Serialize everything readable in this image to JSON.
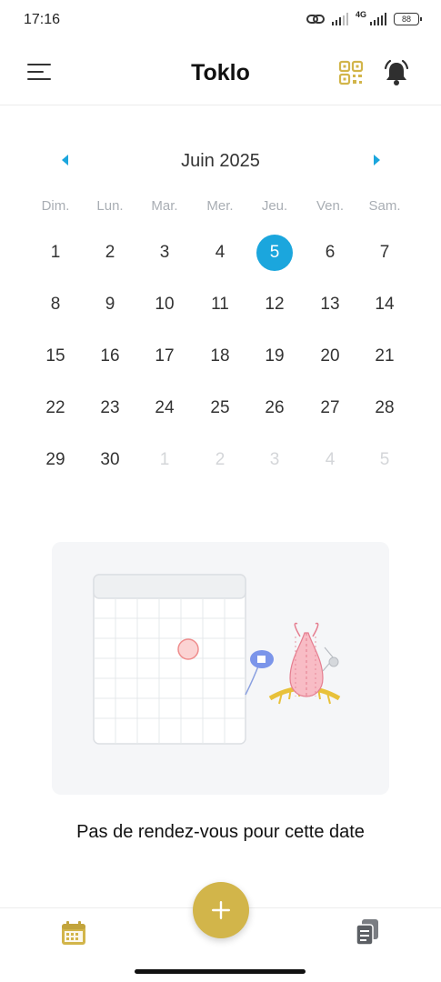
{
  "status_bar": {
    "time": "17:16",
    "network": "4G",
    "battery": "88"
  },
  "header": {
    "title": "Toklo",
    "icons": {
      "menu": "menu-icon",
      "qr": "qr-code-icon",
      "notifications": "bell-icon"
    }
  },
  "calendar": {
    "month_label": "Juin 2025",
    "weekdays": [
      "Dim.",
      "Lun.",
      "Mar.",
      "Mer.",
      "Jeu.",
      "Ven.",
      "Sam."
    ],
    "weeks": [
      [
        {
          "d": "1",
          "m": false
        },
        {
          "d": "2",
          "m": false
        },
        {
          "d": "3",
          "m": false
        },
        {
          "d": "4",
          "m": false
        },
        {
          "d": "5",
          "m": false,
          "sel": true
        },
        {
          "d": "6",
          "m": false
        },
        {
          "d": "7",
          "m": false
        }
      ],
      [
        {
          "d": "8",
          "m": false
        },
        {
          "d": "9",
          "m": false
        },
        {
          "d": "10",
          "m": false
        },
        {
          "d": "11",
          "m": false
        },
        {
          "d": "12",
          "m": false
        },
        {
          "d": "13",
          "m": false
        },
        {
          "d": "14",
          "m": false
        }
      ],
      [
        {
          "d": "15",
          "m": false
        },
        {
          "d": "16",
          "m": false
        },
        {
          "d": "17",
          "m": false
        },
        {
          "d": "18",
          "m": false
        },
        {
          "d": "19",
          "m": false
        },
        {
          "d": "20",
          "m": false
        },
        {
          "d": "21",
          "m": false
        }
      ],
      [
        {
          "d": "22",
          "m": false
        },
        {
          "d": "23",
          "m": false
        },
        {
          "d": "24",
          "m": false
        },
        {
          "d": "25",
          "m": false
        },
        {
          "d": "26",
          "m": false
        },
        {
          "d": "27",
          "m": false
        },
        {
          "d": "28",
          "m": false
        }
      ],
      [
        {
          "d": "29",
          "m": false
        },
        {
          "d": "30",
          "m": false
        },
        {
          "d": "1",
          "m": true
        },
        {
          "d": "2",
          "m": true
        },
        {
          "d": "3",
          "m": true
        },
        {
          "d": "4",
          "m": true
        },
        {
          "d": "5",
          "m": true
        }
      ]
    ],
    "selected_day": "5"
  },
  "empty_state": {
    "message": "Pas de rendez-vous pour cette date"
  },
  "bottom_nav": {
    "icons": [
      "calendar-icon",
      "documents-icon"
    ],
    "fab_icon": "plus-icon"
  },
  "colors": {
    "accent_blue": "#1ba6dd",
    "accent_gold": "#d2b54a",
    "muted_text": "#a9aeb4"
  }
}
